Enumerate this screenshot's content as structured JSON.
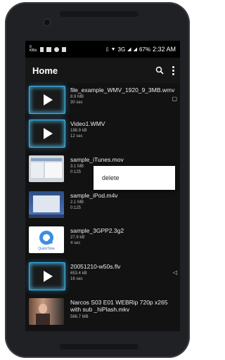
{
  "status_bar": {
    "left_icons": [
      "kb-speed-icon",
      "usb-icon",
      "image-icon",
      "block-icon",
      "nfc-icon"
    ],
    "kb_label": "0\nKB/s",
    "network": "3G",
    "battery": "67%",
    "time": "2:32 AM"
  },
  "appbar": {
    "title": "Home",
    "icons": [
      "search-icon",
      "overflow-menu-icon"
    ]
  },
  "files": [
    {
      "name": "file_example_WMV_1920_9_3MB.wmv",
      "size": "8.9 MB",
      "duration": "30 sec",
      "thumb": "play"
    },
    {
      "name": "Video1.WMV",
      "size": "188.9 kB",
      "duration": "12 sec",
      "thumb": "play"
    },
    {
      "name": "sample_iTunes.mov",
      "size": "3.1 MB",
      "duration": "0:125",
      "thumb": "screenshot"
    },
    {
      "name": "sample_iPod.m4v",
      "size": "2.1 MB",
      "duration": "0:125",
      "thumb": "screenshot"
    },
    {
      "name": "sample_3GPP2.3g2",
      "size": "27.9 kB",
      "duration": "4 sec",
      "thumb": "quicktime"
    },
    {
      "name": "20051210-w50s.flv",
      "size": "653.4 kB",
      "duration": "16 sec",
      "thumb": "play"
    },
    {
      "name": "Narcos S03 E01 WEBRip 720p x265 with sub _hiPlash.mkv",
      "size": "566.7 MB",
      "duration": "",
      "thumb": "photo"
    }
  ],
  "context_menu": {
    "items": [
      "delete"
    ]
  },
  "quicktime_label": "QuickTime",
  "colors": {
    "accent": "#39b7ea",
    "background": "#121212"
  }
}
